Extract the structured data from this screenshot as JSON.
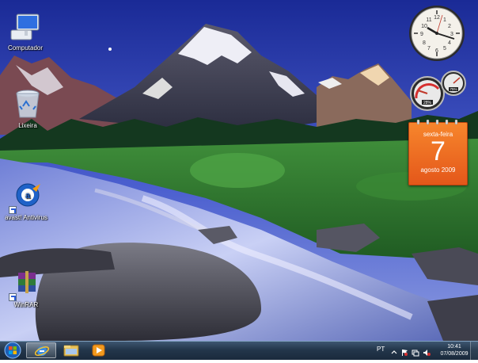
{
  "desktop": {
    "icons": [
      {
        "label": "Computador",
        "icon": "computer-icon"
      },
      {
        "label": "Lixeira",
        "icon": "recycle-bin-icon"
      },
      {
        "label": "avast! Antivirus",
        "icon": "avast-icon"
      },
      {
        "label": "WinRAR",
        "icon": "winrar-icon"
      }
    ]
  },
  "gadgets": {
    "clock": {
      "time": "10:41"
    },
    "cpu_meter": {
      "cpu_percent": 28,
      "memory_percent": 75,
      "cpu_label": "28%",
      "memory_label": "75%"
    },
    "calendar": {
      "weekday": "sexta-feira",
      "day": "7",
      "month_year": "agosto 2009"
    }
  },
  "taskbar": {
    "pinned": [
      {
        "icon": "internet-explorer-icon",
        "active": true
      },
      {
        "icon": "windows-explorer-icon",
        "active": false
      },
      {
        "icon": "media-player-icon",
        "active": false
      }
    ],
    "tray": {
      "language": "PT",
      "time": "10:41",
      "date": "07/08/2009"
    }
  },
  "colors": {
    "taskbar": "#23364b",
    "calendar": "#e4571a",
    "sky_top": "#1b2f9a"
  }
}
